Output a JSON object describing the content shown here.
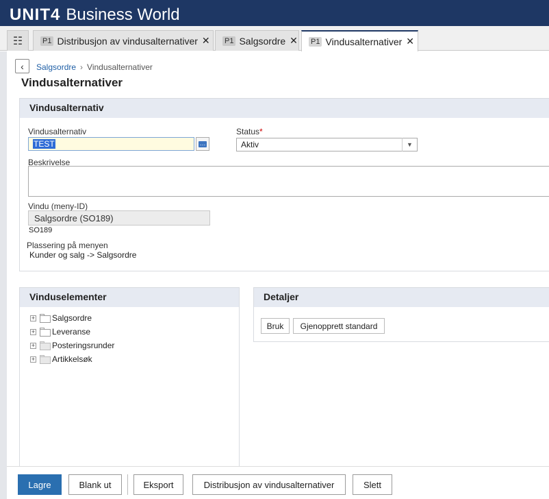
{
  "app": {
    "logo": "UNIT4",
    "product": "Business World"
  },
  "tabs": [
    {
      "prefix": "P1",
      "label": "Distribusjon av vindusalternativer"
    },
    {
      "prefix": "P1",
      "label": "Salgsordre"
    },
    {
      "prefix": "P1",
      "label": "Vindusalternativer",
      "active": true
    }
  ],
  "icons": {
    "menu": "grid-menu-icon",
    "close": "close-icon",
    "back": "chevron-left-icon",
    "lookup": "lookup-icon",
    "dropdown": "chevron-down-icon",
    "expand": "plus-expander-icon",
    "folder": "folder-icon"
  },
  "colors": {
    "brand": "#1e3764",
    "primary_button": "#2a6fb0",
    "link": "#1f5fa6",
    "panel_header": "#e6eaf2",
    "required": "#cc0000"
  },
  "breadcrumb": {
    "parent": "Salgsordre",
    "current": "Vindusalternativer"
  },
  "page_title": "Vindusalternativer",
  "form": {
    "section_title": "Vindusalternativ",
    "alternative": {
      "label": "Vindusalternativ",
      "value": "TEST"
    },
    "status": {
      "label": "Status",
      "required_mark": "*",
      "value": "Aktiv"
    },
    "description": {
      "label": "Beskrivelse",
      "value": ""
    },
    "window": {
      "label": "Vindu (meny-ID)",
      "value": "Salgsordre (SO189)",
      "code": "SO189"
    },
    "menu_placement": {
      "label": "Plassering på menyen",
      "value": "Kunder og salg -> Salgsordre"
    }
  },
  "window_elements": {
    "title": "Vinduselementer",
    "items": [
      {
        "label": "Salgsordre",
        "folder": "white"
      },
      {
        "label": "Leveranse",
        "folder": "white"
      },
      {
        "label": "Posteringsrunder",
        "folder": "gray"
      },
      {
        "label": "Artikkelsøk",
        "folder": "gray"
      }
    ]
  },
  "details": {
    "title": "Detaljer",
    "use_label": "Bruk",
    "restore_label": "Gjenopprett standard"
  },
  "footer": {
    "save_label": "Lagre",
    "clear_label": "Blank ut",
    "export_label": "Eksport",
    "distribute_label": "Distribusjon av vindusalternativer",
    "delete_label": "Slett"
  }
}
